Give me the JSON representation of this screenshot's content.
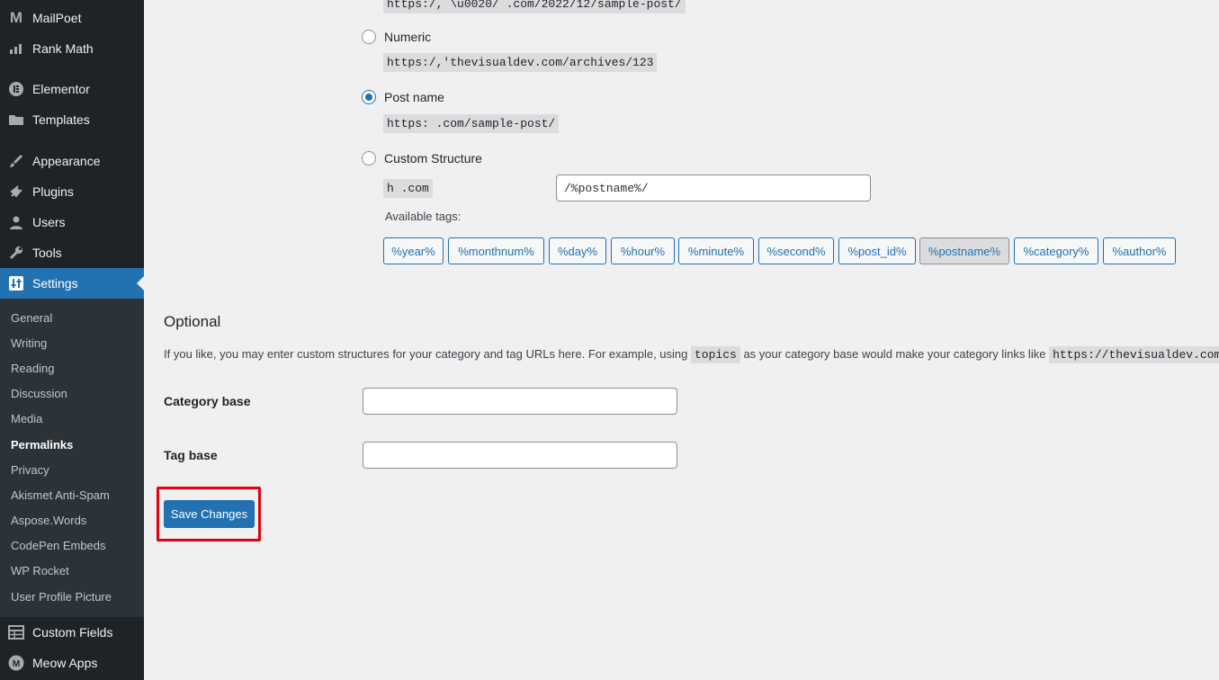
{
  "sidebar": {
    "items": [
      {
        "label": "MailPoet",
        "icon": "mailpoet-icon"
      },
      {
        "label": "Rank Math",
        "icon": "rank-math-icon"
      },
      {
        "label": "Elementor",
        "icon": "elementor-icon"
      },
      {
        "label": "Templates",
        "icon": "folder-icon"
      },
      {
        "label": "Appearance",
        "icon": "paintbrush-icon"
      },
      {
        "label": "Plugins",
        "icon": "plug-icon"
      },
      {
        "label": "Users",
        "icon": "user-icon"
      },
      {
        "label": "Tools",
        "icon": "wrench-icon"
      },
      {
        "label": "Settings",
        "icon": "settings-icon"
      },
      {
        "label": "Custom Fields",
        "icon": "table-icon"
      },
      {
        "label": "Meow Apps",
        "icon": "meow-icon"
      }
    ],
    "submenu": [
      "General",
      "Writing",
      "Reading",
      "Discussion",
      "Media",
      "Permalinks",
      "Privacy",
      "Akismet Anti-Spam",
      "Aspose.Words",
      "CodePen Embeds",
      "WP Rocket",
      "User Profile Picture"
    ],
    "current_submenu": "Permalinks"
  },
  "permalinks": {
    "top_example": "https:/,         \\u0020/ .com/2022/12/sample-post/",
    "numeric_label": "Numeric",
    "numeric_example": "https:/,'thevisualdev.com/archives/123",
    "postname_label": "Post name",
    "postname_example": "https:             .com/sample-post/",
    "custom_label": "Custom Structure",
    "custom_prefix": "h               .com",
    "custom_value": "/%postname%/",
    "available_tags_label": "Available tags:",
    "tags": [
      "%year%",
      "%monthnum%",
      "%day%",
      "%hour%",
      "%minute%",
      "%second%",
      "%post_id%",
      "%postname%",
      "%category%",
      "%author%"
    ],
    "selected": "Post name"
  },
  "optional": {
    "heading": "Optional",
    "desc_before": "If you like, you may enter custom structures for your category and tag URLs here. For example, using",
    "desc_code1": "topics",
    "desc_middle": "as your category base would make your category links like",
    "desc_code2": "https://thevisualdev.com/topics/uncategorized/",
    "category_base_label": "Category base",
    "category_base_value": "",
    "tag_base_label": "Tag base",
    "tag_base_value": ""
  },
  "save_label": "Save Changes",
  "colors": {
    "accent": "#2271b1",
    "sidebar_bg": "#1d2327",
    "highlight": "#e3000f"
  }
}
